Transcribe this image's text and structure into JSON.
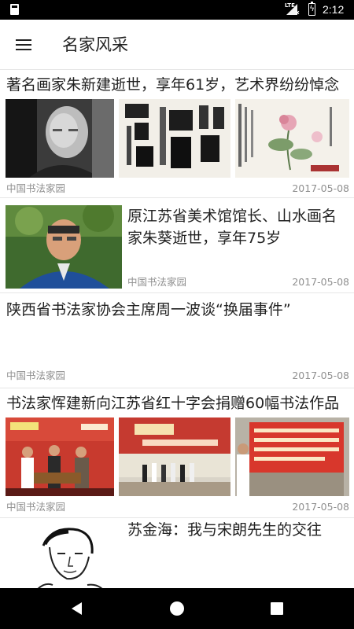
{
  "status_bar": {
    "network": "LTE",
    "signal_badge": "x",
    "time": "2:12"
  },
  "app_bar": {
    "title": "名家风采"
  },
  "articles": [
    {
      "title": "著名画家朱新建逝世，享年61岁，艺术界纷纷悼念",
      "source": "中国书法家园",
      "date": "2017-05-08",
      "images": [
        "portrait-photo",
        "calligraphy-artwork",
        "flower-painting"
      ]
    },
    {
      "title": "原江苏省美术馆馆长、山水画名家朱葵逝世，享年75岁",
      "source": "中国书法家园",
      "date": "2017-05-08",
      "images": [
        "portrait-photo"
      ]
    },
    {
      "title": "陕西省书法家协会主席周一波谈“换届事件”",
      "source": "中国书法家园",
      "date": "2017-05-08",
      "images": []
    },
    {
      "title": "书法家恽建新向江苏省红十字会捐赠60幅书法作品",
      "source": "中国书法家园",
      "date": "2017-05-08",
      "images": [
        "donation-ceremony-photo",
        "exhibition-hall-photo",
        "donation-banner-photo"
      ]
    },
    {
      "title": "苏金海：我与宋朗先生的交往",
      "source": "",
      "date": "",
      "images": [
        "ink-sketch-portrait"
      ]
    }
  ],
  "nav_bar": {
    "icons": [
      "back-icon",
      "home-icon",
      "recent-apps-icon"
    ]
  },
  "colors": {
    "status_bar": "#000000",
    "nav_bar": "#000000",
    "divider": "#e6e6e6",
    "meta_text": "#8f8f8f",
    "title_text": "#212121"
  }
}
